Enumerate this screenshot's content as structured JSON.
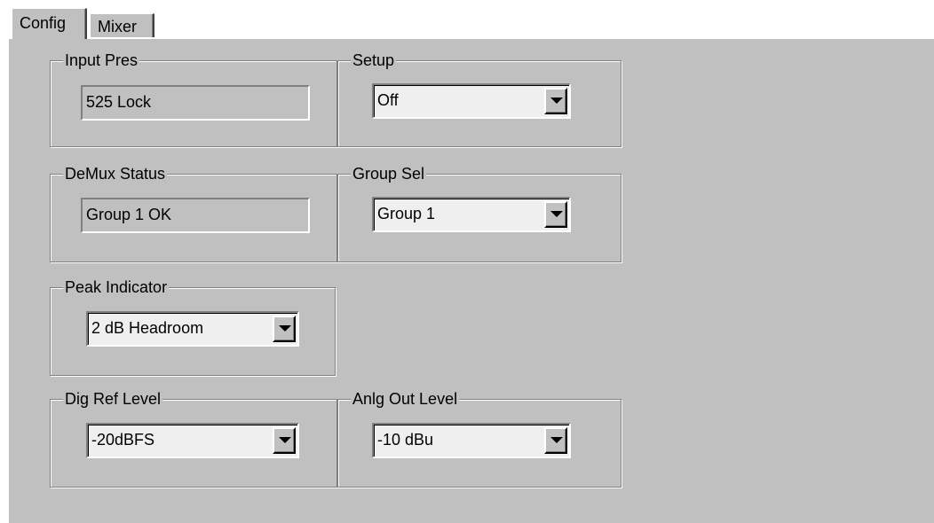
{
  "tabs": [
    {
      "label": "Config",
      "active": true
    },
    {
      "label": "Mixer",
      "active": false
    }
  ],
  "groups": {
    "input_pres": {
      "label": "Input Pres",
      "value": "525 Lock"
    },
    "setup": {
      "label": "Setup",
      "value": "Off"
    },
    "demux_status": {
      "label": "DeMux Status",
      "value": "Group 1 OK"
    },
    "group_sel": {
      "label": "Group Sel",
      "value": "Group 1"
    },
    "peak_indicator": {
      "label": "Peak Indicator",
      "value": "2 dB Headroom"
    },
    "dig_ref_level": {
      "label": "Dig Ref Level",
      "value": "-20dBFS"
    },
    "anlg_out_level": {
      "label": "Anlg Out Level",
      "value": "-10 dBu"
    }
  },
  "icons": {
    "dropdown": "chevron-down-icon"
  },
  "colors": {
    "face": "#c0c0c0",
    "field": "#efefef",
    "shadow": "#808080",
    "highlight": "#ffffff"
  }
}
